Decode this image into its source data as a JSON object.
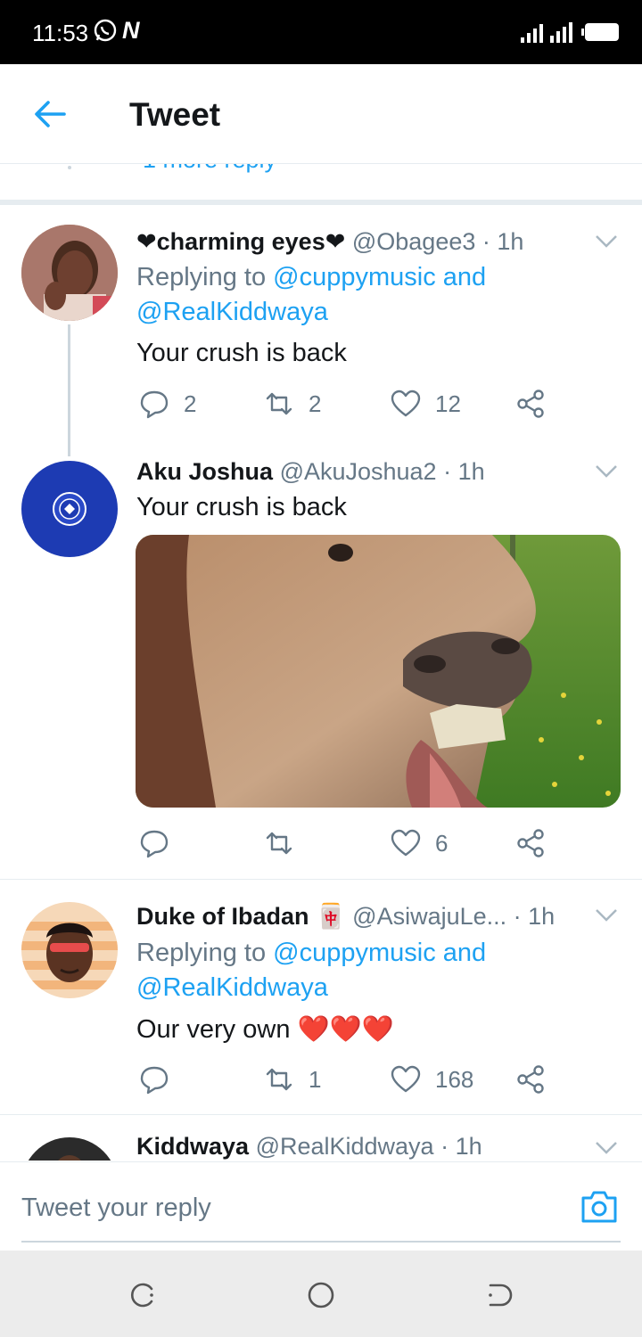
{
  "status": {
    "time": "11:53",
    "n_badge": "N"
  },
  "header": {
    "title": "Tweet"
  },
  "more_replies": "1 more reply",
  "tweets": [
    {
      "name": "❤charming eyes❤",
      "handle": "@Obagee3",
      "time": "· 1h",
      "replying_prefix": "Replying to ",
      "mention1": "@cuppymusic and",
      "mention2": "@RealKiddwaya",
      "text": "Your crush is back",
      "replies": "2",
      "retweets": "2",
      "likes": "12"
    },
    {
      "name": "Aku Joshua",
      "handle": "@AkuJoshua2",
      "time": "· 1h",
      "text": "Your crush is back",
      "replies": "",
      "retweets": "",
      "likes": "6"
    },
    {
      "name": "Duke of Ibadan 🀄",
      "handle": "@AsiwajuLe...",
      "time": "· 1h",
      "replying_prefix": "Replying to ",
      "mention1": "@cuppymusic and",
      "mention2": "@RealKiddwaya",
      "text": "Our very own ❤️❤️❤️",
      "replies": "",
      "retweets": "1",
      "likes": "168"
    },
    {
      "name": "Kiddwaya",
      "handle": "@RealKiddwaya",
      "time": "· 1h"
    }
  ],
  "reply_bar": {
    "placeholder": "Tweet your reply"
  },
  "colors": {
    "accent": "#1da1f2",
    "muted": "#657786",
    "heart": "#e0245e"
  }
}
